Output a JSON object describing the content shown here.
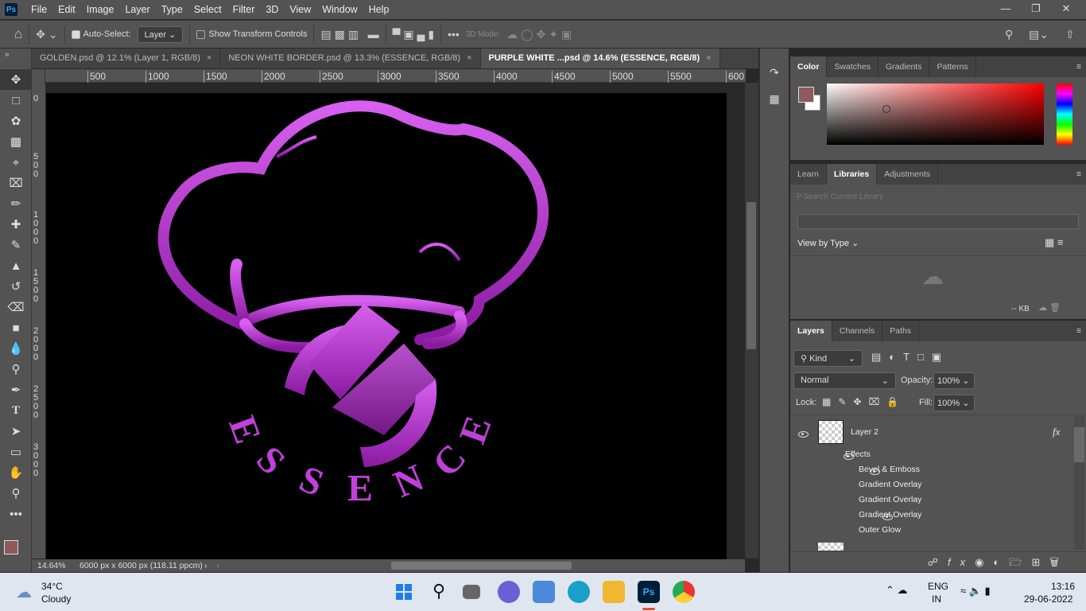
{
  "app": {
    "logo": "Ps",
    "menu": [
      "File",
      "Edit",
      "Image",
      "Layer",
      "Type",
      "Select",
      "Filter",
      "3D",
      "View",
      "Window",
      "Help"
    ]
  },
  "options": {
    "auto_select_label": "Auto-Select:",
    "auto_select_checked": true,
    "layer_dropdown": "Layer",
    "show_transform_label": "Show Transform Controls",
    "show_transform_checked": false,
    "mode_3d_label": "3D Mode:"
  },
  "tabs": [
    {
      "label": "GOLDEN.psd @ 12.1% (Layer 1, RGB/8)",
      "active": false
    },
    {
      "label": "NEON WHITE BORDER.psd @ 13.3% (ESSENCE, RGB/8)",
      "active": false
    },
    {
      "label": "PURPLE WHITE ...psd @ 14.6% (ESSENCE, RGB/8)",
      "active": true
    }
  ],
  "ruler": {
    "h": [
      "500",
      "1000",
      "1500",
      "2000",
      "2500",
      "3000",
      "3500",
      "4000",
      "4500",
      "5000",
      "5500",
      "600"
    ],
    "v": [
      "0",
      "500",
      "1000",
      "1500",
      "2000",
      "2500",
      "3000"
    ]
  },
  "canvas": {
    "logo_text": "ESSENCE",
    "logo_color": "#c040d8"
  },
  "status": {
    "zoom": "14.64%",
    "doc_info": "6000 px x 6000 px (118.11 ppcm)"
  },
  "color_panel": {
    "tabs": [
      "Color",
      "Swatches",
      "Gradients",
      "Patterns"
    ],
    "foreground": "#8e5a5a",
    "background": "#ffffff"
  },
  "libraries_panel": {
    "tabs": [
      "Learn",
      "Libraries",
      "Adjustments"
    ],
    "search_placeholder": "Search Current Library",
    "view_by": "View by Type",
    "size": "-- KB"
  },
  "layers_panel": {
    "tabs": [
      "Layers",
      "Channels",
      "Paths"
    ],
    "filter_kind": "Kind",
    "blend_mode": "Normal",
    "opacity_label": "Opacity:",
    "opacity": "100%",
    "lock_label": "Lock:",
    "fill_label": "Fill:",
    "fill": "100%",
    "layers": [
      {
        "name": "Layer 2",
        "fx": "fx",
        "effects_label": "Effects",
        "effects": [
          {
            "name": "Bevel & Emboss",
            "visible": true
          },
          {
            "name": "Gradient Overlay",
            "visible": false
          },
          {
            "name": "Gradient Overlay",
            "visible": false
          },
          {
            "name": "Gradient Overlay",
            "visible": true
          },
          {
            "name": "Outer Glow",
            "visible": false
          }
        ]
      }
    ]
  },
  "taskbar": {
    "weather_temp": "34°C",
    "weather_desc": "Cloudy",
    "lang": "ENG",
    "region": "IN",
    "time": "13:16",
    "date": "29-06-2022"
  }
}
